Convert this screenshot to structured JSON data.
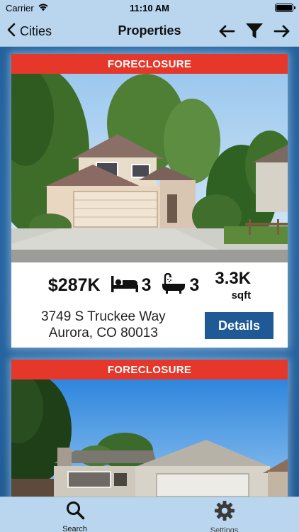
{
  "status_bar": {
    "carrier": "Carrier",
    "time": "11:10 AM",
    "battery_level": 1.0
  },
  "nav": {
    "back_label": "Cities",
    "title": "Properties",
    "icons": [
      "chevron-left-icon",
      "arrow-left-icon",
      "filter-icon",
      "arrow-right-icon"
    ]
  },
  "listings": [
    {
      "banner": "FORECLOSURE",
      "price": "$287K",
      "beds": "3",
      "baths": "3",
      "sqft_value": "3.3K",
      "sqft_unit": "sqft",
      "address_line1": "3749 S Truckee Way",
      "address_line2": "Aurora, CO 80013",
      "details_label": "Details"
    },
    {
      "banner": "FORECLOSURE"
    }
  ],
  "tabs": [
    {
      "label": "Search",
      "icon": "search-icon",
      "selected": true
    },
    {
      "label": "Settings",
      "icon": "gear-icon",
      "selected": false
    }
  ],
  "colors": {
    "banner_red": "#e5382a",
    "details_blue": "#1f5a97",
    "bar_bg": "#b9d6ee",
    "background_blue": "#2b6cab"
  }
}
